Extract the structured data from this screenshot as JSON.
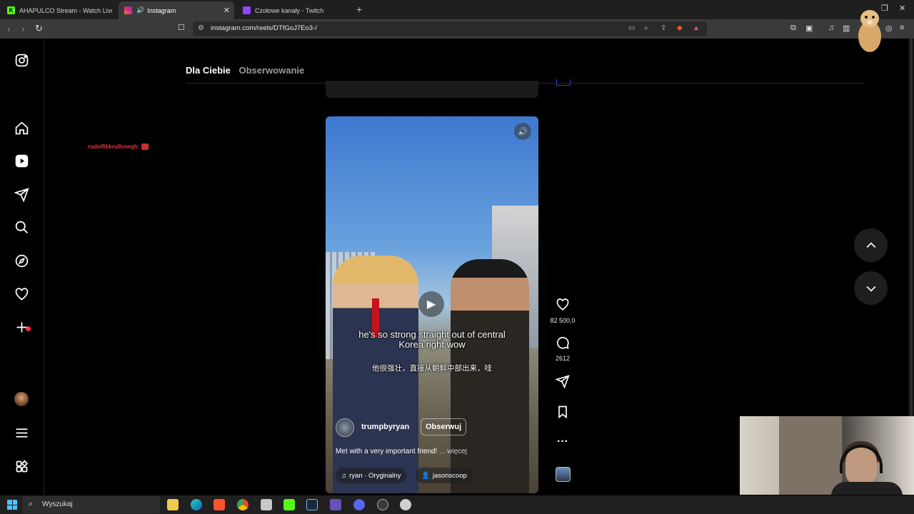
{
  "browser": {
    "tabs": [
      {
        "title": "AHAPULCO Stream - Watch Live on K",
        "favicon": "kick-icon",
        "active": false
      },
      {
        "title": "Instagram",
        "favicon": "instagram-icon",
        "active": true
      },
      {
        "title": "Czołowe kanały - Twitch",
        "favicon": "twitch-icon",
        "active": false
      }
    ],
    "url": "instagram.com/reels/DTfGoJ7Eo3-/"
  },
  "chat_overlay": {
    "text": "rudolfikkrulhowgh:"
  },
  "feed": {
    "tab_for_you": "Dla Ciebie",
    "tab_following": "Obserwowanie"
  },
  "reel": {
    "subtitle_en": "he's so strong straight out of central Korea right wow",
    "subtitle_zh": "他很强壮，直接从朝鲜中部出来，哇",
    "owner": "trumpbyryan",
    "follow_label": "Obserwuj",
    "caption": "Met with a very important friend!",
    "caption_more": "... więcej",
    "audio": "ryan · Oryginalny",
    "collaborator": "jasonscoop"
  },
  "actions": {
    "likes": "82 500,0",
    "comments": "2612"
  },
  "taskbar": {
    "search_label": "Wyszukaj"
  },
  "colors": {
    "accent_red": "#ff3040",
    "background": "#000000"
  }
}
